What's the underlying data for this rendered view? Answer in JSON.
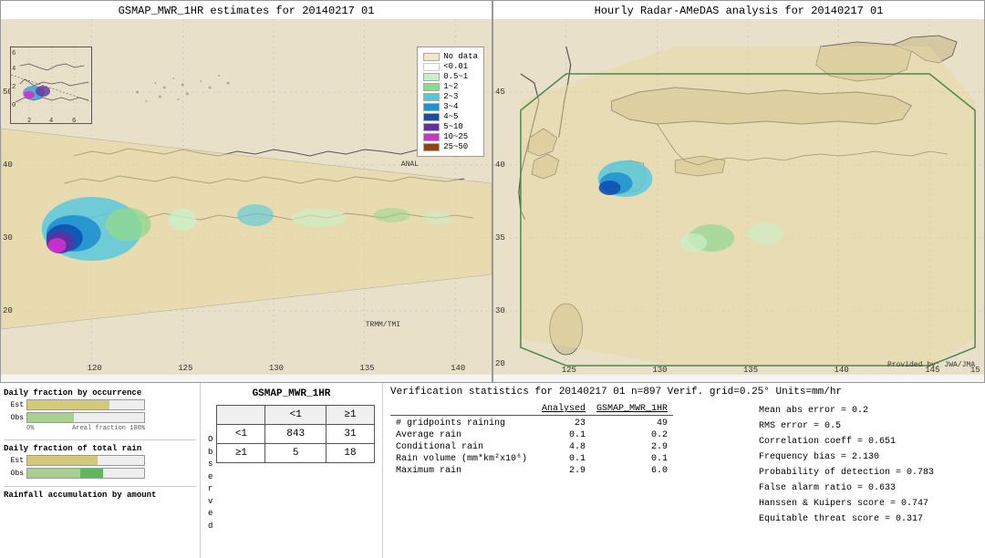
{
  "left_map": {
    "title": "GSMAP_MWR_1HR estimates for 20140217 01",
    "label_anal": "ANAL",
    "label_trmm": "TRMM/TMI"
  },
  "right_map": {
    "title": "Hourly Radar-AMeDAS analysis for 20140217 01",
    "label_jwa": "Provided by: JWA/JMA"
  },
  "legend": {
    "items": [
      {
        "label": "No data",
        "color": "#f0e8c8"
      },
      {
        "label": "<0.01",
        "color": "#ffffff"
      },
      {
        "label": "0.5~1",
        "color": "#c8f0c8"
      },
      {
        "label": "1~2",
        "color": "#90d890"
      },
      {
        "label": "2~3",
        "color": "#50c8e0"
      },
      {
        "label": "3~4",
        "color": "#2090d0"
      },
      {
        "label": "4~5",
        "color": "#1050b0"
      },
      {
        "label": "5~10",
        "color": "#6030a0"
      },
      {
        "label": "10~25",
        "color": "#d030d0"
      },
      {
        "label": "25~50",
        "color": "#8b4513"
      }
    ]
  },
  "charts": {
    "occurrence_title": "Daily fraction by occurrence",
    "rain_title": "Daily fraction of total rain",
    "accumulation_title": "Rainfall accumulation by amount",
    "est_label": "Est",
    "obs_label": "Obs",
    "axis_0": "0%",
    "axis_100": "Areal fraction",
    "axis_100_label": "100%"
  },
  "contingency": {
    "title": "GSMAP_MWR_1HR",
    "col_less1": "<1",
    "col_geq1": "≥1",
    "row_less1": "<1",
    "row_geq1": "≥1",
    "observed_label": "O\nb\ns\ne\nr\nv\ne\nd",
    "val_00": "843",
    "val_01": "31",
    "val_10": "5",
    "val_11": "18"
  },
  "stats": {
    "header": "Verification statistics for 20140217 01   n=897   Verif. grid=0.25°   Units=mm/hr",
    "col_analysed": "Analysed",
    "col_gsmap": "GSMAP_MWR_1HR",
    "divider": "-------------------------------------------------------",
    "rows": [
      {
        "label": "# gridpoints raining",
        "val1": "23",
        "val2": "49"
      },
      {
        "label": "Average rain",
        "val1": "0.1",
        "val2": "0.2"
      },
      {
        "label": "Conditional rain",
        "val1": "4.8",
        "val2": "2.9"
      },
      {
        "label": "Rain volume (mm*km²x10⁶)",
        "val1": "0.1",
        "val2": "0.1"
      },
      {
        "label": "Maximum rain",
        "val1": "2.9",
        "val2": "6.0"
      }
    ],
    "right_stats": [
      "Mean abs error = 0.2",
      "RMS error = 0.5",
      "Correlation coeff = 0.651",
      "Frequency bias = 2.130",
      "Probability of detection = 0.783",
      "False alarm ratio = 0.633",
      "Hanssen & Kuipers score = 0.747",
      "Equitable threat score = 0.317"
    ]
  }
}
